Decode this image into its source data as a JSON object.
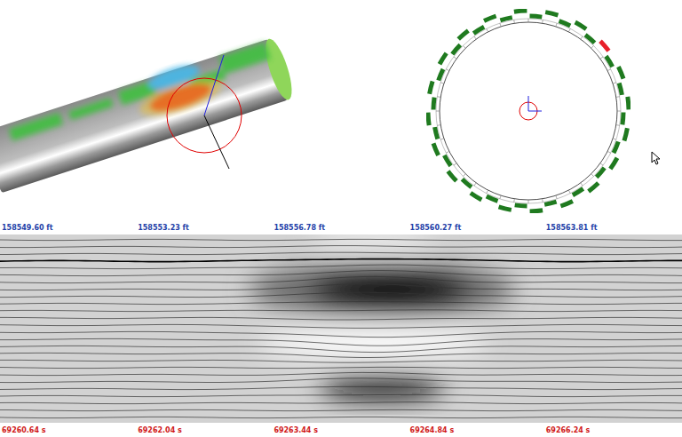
{
  "pipe_view": {
    "crosshair": true
  },
  "ring": {
    "segments": [
      {
        "color": "#1f7a1f"
      },
      {
        "color": "#1f7a1f"
      },
      {
        "color": "#1f7a1f"
      },
      {
        "color": "#1f7a1f"
      },
      {
        "color": "#1f7a1f"
      },
      {
        "color": "#e8202a"
      },
      {
        "color": "#1f7a1f"
      },
      {
        "color": "#1f7a1f"
      },
      {
        "color": "#1f7a1f"
      },
      {
        "color": "#1f7a1f"
      },
      {
        "color": "#1f7a1f"
      },
      {
        "color": "#1f7a1f"
      },
      {
        "color": "#1f7a1f"
      },
      {
        "color": "#1f7a1f"
      },
      {
        "color": "#1f7a1f"
      },
      {
        "color": "#1f7a1f"
      },
      {
        "color": "#1f7a1f"
      },
      {
        "color": "#1f7a1f"
      },
      {
        "color": "#1f7a1f"
      },
      {
        "color": "#1f7a1f"
      },
      {
        "color": "#1f7a1f"
      },
      {
        "color": "#1f7a1f"
      },
      {
        "color": "#1f7a1f"
      },
      {
        "color": "#1f7a1f"
      },
      {
        "color": "#1f7a1f"
      },
      {
        "color": "#1f7a1f"
      },
      {
        "color": "#1f7a1f"
      },
      {
        "color": "#1f7a1f"
      },
      {
        "color": "#1f7a1f"
      },
      {
        "color": "#1f7a1f"
      },
      {
        "color": "#1f7a1f"
      },
      {
        "color": "#1f7a1f"
      },
      {
        "color": "#1f7a1f"
      },
      {
        "color": "#1f7a1f"
      },
      {
        "color": "#1f7a1f"
      },
      {
        "color": "#1f7a1f"
      },
      {
        "color": "#1f7a1f"
      },
      {
        "color": "#1f7a1f"
      },
      {
        "color": "#1f7a1f"
      },
      {
        "color": "#1f7a1f"
      }
    ]
  },
  "distance_axis": {
    "labels": [
      "158549.60 ft",
      "158553.23 ft",
      "158556.78 ft",
      "158560.27 ft",
      "158563.81 ft"
    ]
  },
  "signal": {
    "traces": [
      0,
      -1,
      -2,
      -3,
      -4,
      -5,
      -6,
      -6,
      -5,
      -3,
      -1,
      2,
      4,
      6,
      7,
      6,
      4,
      2,
      0,
      -2,
      -4,
      -3,
      -2,
      -1,
      0,
      0
    ]
  },
  "time_axis": {
    "labels": [
      "69260.64 s",
      "69262.04 s",
      "69263.44 s",
      "69264.84 s",
      "69266.24 s"
    ]
  }
}
